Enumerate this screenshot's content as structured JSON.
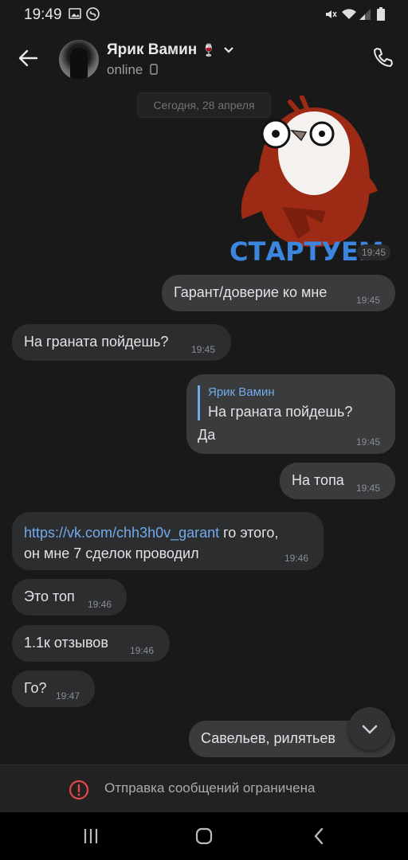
{
  "status_bar": {
    "time": "19:49"
  },
  "header": {
    "name": "Ярик Вамин",
    "emoji": "🍷",
    "status": "online"
  },
  "chat": {
    "date_label": "Сегодня, 28 апреля",
    "sticker": {
      "text": "СТАРТУЕМ",
      "time": "19:45"
    },
    "messages": [
      {
        "dir": "out",
        "text": "Гарант/доверие ко мне",
        "time": "19:45"
      },
      {
        "dir": "in",
        "text": "На граната пойдешь?",
        "time": "19:45"
      },
      {
        "dir": "out",
        "reply_author": "Ярик Вамин",
        "reply_text": "На граната пойдешь?",
        "text": "Да",
        "time": "19:45"
      },
      {
        "dir": "out",
        "text": "На топа",
        "time": "19:45"
      },
      {
        "dir": "in",
        "link": "https://vk.com/chh3h0v_garant",
        "text_after_link": " го этого,",
        "text_line2": "он мне 7 сделок проводил",
        "time": "19:46"
      },
      {
        "dir": "in",
        "text": "Это топ",
        "time": "19:46"
      },
      {
        "dir": "in",
        "text": "1.1к отзывов",
        "time": "19:46"
      },
      {
        "dir": "in",
        "text": "Го?",
        "time": "19:47"
      },
      {
        "dir": "out",
        "text": "Савельев, рилятьев"
      }
    ]
  },
  "composer": {
    "restriction_text": "Отправка сообщений ограничена"
  },
  "colors": {
    "background": "#191919",
    "bubble_in": "#2c2d2e",
    "bubble_out": "#3a3b3c",
    "link": "#71aaeb",
    "warning": "#e64646"
  },
  "icons": [
    "gallery-icon",
    "shazam-icon",
    "mute-icon",
    "wifi-icon",
    "signal-icon",
    "battery-icon",
    "back-arrow-icon",
    "chevron-down-icon",
    "phone-icon",
    "mobile-icon",
    "warning-icon",
    "recent-apps-icon",
    "home-icon",
    "nav-back-icon"
  ]
}
